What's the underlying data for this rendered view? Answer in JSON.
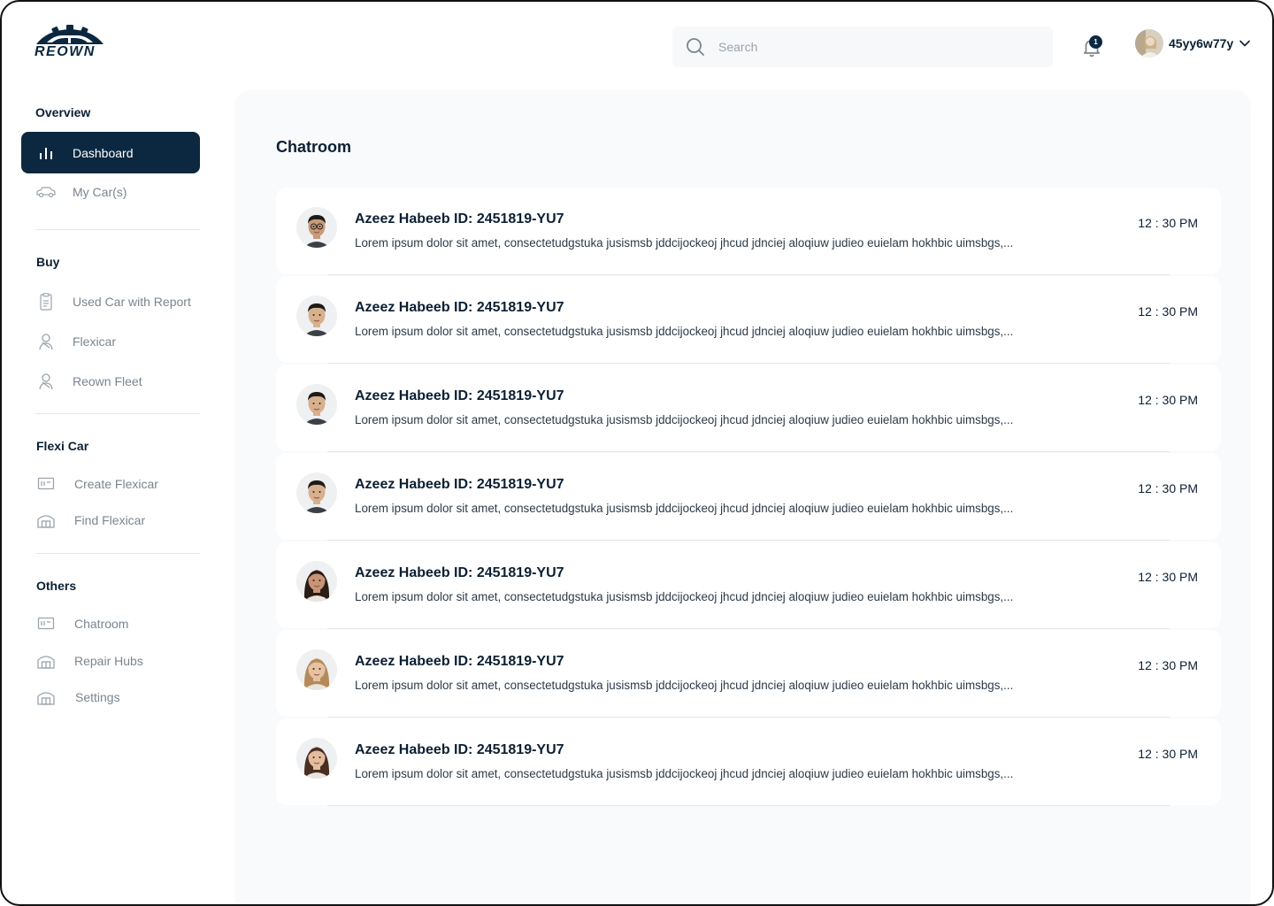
{
  "brand": {
    "name": "REOWN",
    "color": "#0c2840"
  },
  "topbar": {
    "search_placeholder": "Search",
    "notification_count": "1",
    "user_name": "45yy6w77y"
  },
  "sidebar": {
    "sections": {
      "overview": "Overview",
      "buy": "Buy",
      "flexi": "Flexi Car",
      "others": "Others"
    },
    "items": {
      "dashboard": "Dashboard",
      "my_cars": "My Car(s)",
      "used_car": "Used Car with Report",
      "flexicar": "Flexicar",
      "reown_fleet": "Reown Fleet",
      "create_flexicar": "Create Flexicar",
      "find_flexicar": "Find Flexicar",
      "chatroom": "Chatroom",
      "repair_hubs": "Repair Hubs",
      "settings": "Settings"
    }
  },
  "main": {
    "title": "Chatroom",
    "chats": [
      {
        "name": "Azeez Habeeb ID: 2451819-YU7",
        "message": "Lorem ipsum dolor sit amet, consectetudgstuka jusismsb jddcijockeoj jhcud jdnciej aloqiuw judieo euielam hokhbic uimsbgs,...",
        "time": "12 : 30 PM",
        "avatar": "male-glasses"
      },
      {
        "name": "Azeez Habeeb ID: 2451819-YU7",
        "message": "Lorem ipsum dolor sit amet, consectetudgstuka jusismsb jddcijockeoj jhcud jdnciej aloqiuw judieo euielam hokhbic uimsbgs,...",
        "time": "12 : 30 PM",
        "avatar": "male"
      },
      {
        "name": "Azeez Habeeb ID: 2451819-YU7",
        "message": "Lorem ipsum dolor sit amet, consectetudgstuka jusismsb jddcijockeoj jhcud jdnciej aloqiuw judieo euielam hokhbic uimsbgs,...",
        "time": "12 : 30 PM",
        "avatar": "male"
      },
      {
        "name": "Azeez Habeeb ID: 2451819-YU7",
        "message": "Lorem ipsum dolor sit amet, consectetudgstuka jusismsb jddcijockeoj jhcud jdnciej aloqiuw judieo euielam hokhbic uimsbgs,...",
        "time": "12 : 30 PM",
        "avatar": "male"
      },
      {
        "name": "Azeez Habeeb ID: 2451819-YU7",
        "message": "Lorem ipsum dolor sit amet, consectetudgstuka jusismsb jddcijockeoj jhcud jdnciej aloqiuw judieo euielam hokhbic uimsbgs,...",
        "time": "12 : 30 PM",
        "avatar": "female-dark"
      },
      {
        "name": "Azeez Habeeb ID: 2451819-YU7",
        "message": "Lorem ipsum dolor sit amet, consectetudgstuka jusismsb jddcijockeoj jhcud jdnciej aloqiuw judieo euielam hokhbic uimsbgs,...",
        "time": "12 : 30 PM",
        "avatar": "female-blonde"
      },
      {
        "name": "Azeez Habeeb ID: 2451819-YU7",
        "message": "Lorem ipsum dolor sit amet, consectetudgstuka jusismsb jddcijockeoj jhcud jdnciej aloqiuw judieo euielam hokhbic uimsbgs,...",
        "time": "12 : 30 PM",
        "avatar": "female-brown"
      }
    ]
  }
}
